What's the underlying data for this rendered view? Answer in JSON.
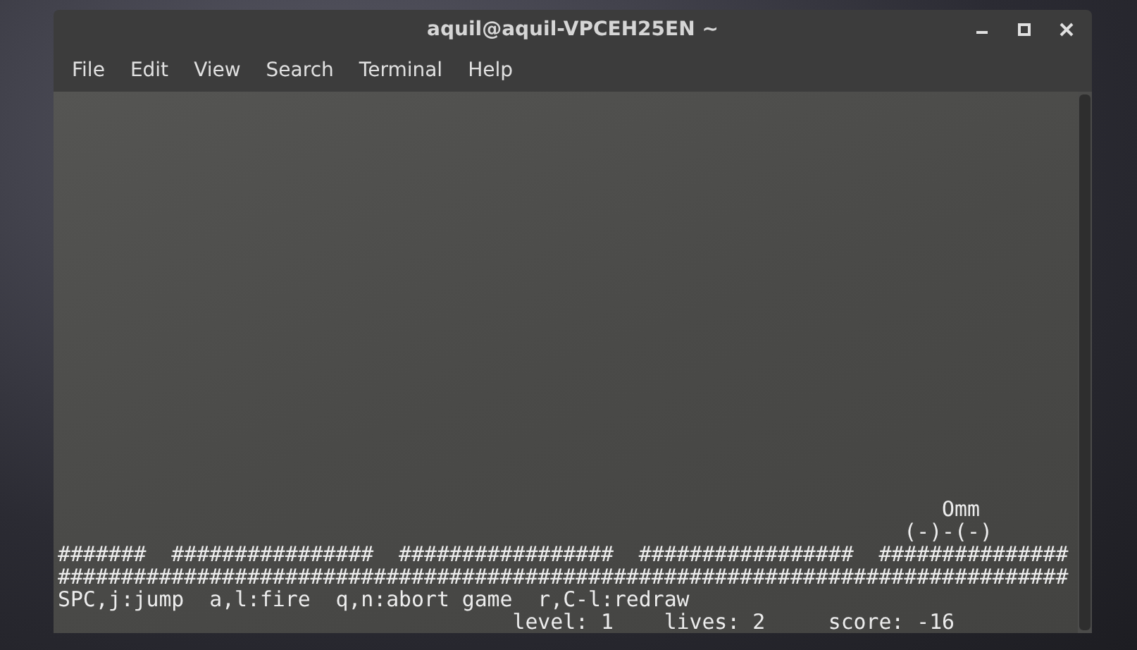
{
  "window": {
    "title": "aquil@aquil-VPCEH25EN ~"
  },
  "menu": [
    "File",
    "Edit",
    "View",
    "Search",
    "Terminal",
    "Help"
  ],
  "terminal": {
    "lines": [
      "                                                                      Omm",
      "                                                                   (-)-(-)",
      "#######  ################  #################  #################  ###############",
      "################################################################################",
      "SPC,j:jump  a,l:fire  q,n:abort game  r,C-l:redraw",
      "                                    level: 1    lives: 2     score: -16"
    ]
  }
}
